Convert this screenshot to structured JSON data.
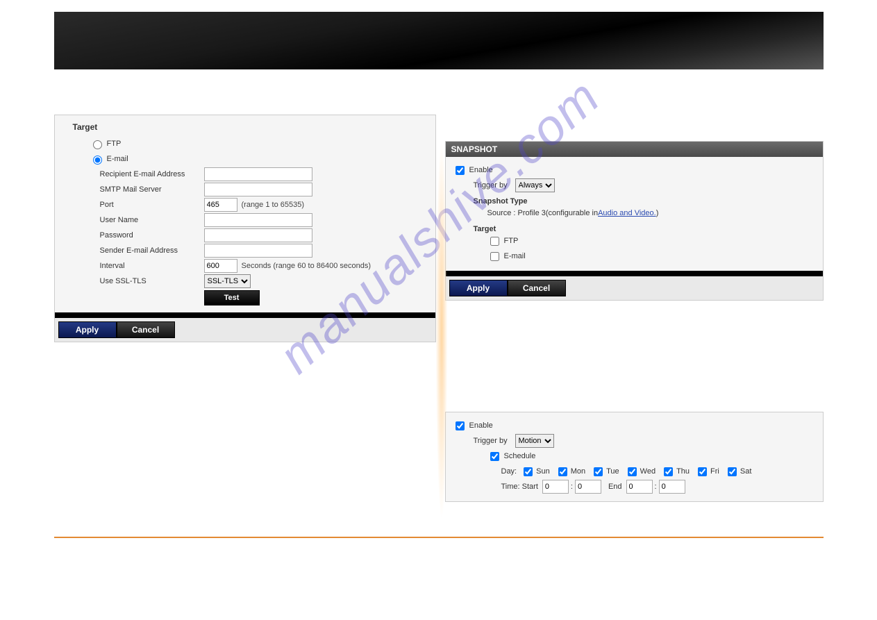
{
  "watermark": "manualshive.com",
  "left_panel": {
    "section": "Target",
    "radio_ftp": "FTP",
    "radio_email": "E-mail",
    "fields": {
      "recipient": "Recipient E-mail Address",
      "smtp": "SMTP Mail Server",
      "port": "Port",
      "port_value": "465",
      "port_hint": "(range 1 to 65535)",
      "username": "User Name",
      "password": "Password",
      "sender": "Sender E-mail Address",
      "interval": "Interval",
      "interval_value": "600",
      "interval_hint": "Seconds  (range 60 to 86400 seconds)",
      "ssl": "Use SSL-TLS",
      "ssl_value": "SSL-TLS"
    },
    "test_btn": "Test",
    "apply": "Apply",
    "cancel": "Cancel"
  },
  "right_panel_top": {
    "title": "SNAPSHOT",
    "enable": "Enable",
    "trigger_by": "Trigger by",
    "trigger_value": "Always",
    "snapshot_type": "Snapshot Type",
    "source_prefix": "Source : Profile 3(configurable in ",
    "source_link": "Audio and Video.",
    "source_suffix": ")",
    "target": "Target",
    "ftp": "FTP",
    "email": "E-mail",
    "apply": "Apply",
    "cancel": "Cancel"
  },
  "right_panel_bottom": {
    "enable": "Enable",
    "trigger_by": "Trigger by",
    "trigger_value": "Motion",
    "schedule": "Schedule",
    "day_label": "Day:",
    "days": [
      "Sun",
      "Mon",
      "Tue",
      "Wed",
      "Thu",
      "Fri",
      "Sat"
    ],
    "time_start": "Time: Start",
    "time_end": "End",
    "t0": "0",
    "t1": "0",
    "t2": "0",
    "t3": "0"
  }
}
